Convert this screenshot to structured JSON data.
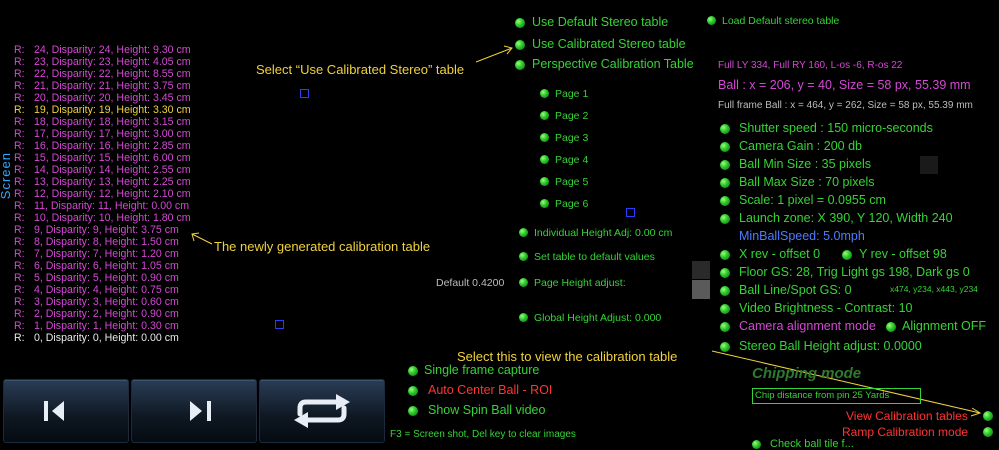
{
  "vertical_label": "Screen",
  "calibration_table": {
    "rows": [
      {
        "r": "R:",
        "text": "24, Disparity: 24, Height: 9.30 cm",
        "style": "pink"
      },
      {
        "r": "R:",
        "text": "23, Disparity: 23, Height: 4.05 cm",
        "style": "pink"
      },
      {
        "r": "R:",
        "text": "22, Disparity: 22, Height: 8.55 cm",
        "style": "pink"
      },
      {
        "r": "R:",
        "text": "21, Disparity: 21, Height: 3.75 cm",
        "style": "pink"
      },
      {
        "r": "R:",
        "text": "20, Disparity: 20, Height: 3.45 cm",
        "style": "pink"
      },
      {
        "r": "R:",
        "text": "19, Disparity: 19, Height: 3.30 cm",
        "style": "yellow"
      },
      {
        "r": "R:",
        "text": "18, Disparity: 18, Height: 3.15 cm",
        "style": "pink"
      },
      {
        "r": "R:",
        "text": "17, Disparity: 17, Height: 3.00 cm",
        "style": "pink"
      },
      {
        "r": "R:",
        "text": "16, Disparity: 16, Height: 2.85 cm",
        "style": "pink"
      },
      {
        "r": "R:",
        "text": "15, Disparity: 15, Height: 6.00 cm",
        "style": "pink"
      },
      {
        "r": "R:",
        "text": "14, Disparity: 14, Height: 2.55 cm",
        "style": "pink"
      },
      {
        "r": "R:",
        "text": "13, Disparity: 13, Height: 2.25 cm",
        "style": "pink"
      },
      {
        "r": "R:",
        "text": "12, Disparity: 12, Height: 2.10 cm",
        "style": "pink"
      },
      {
        "r": "R:",
        "text": "11, Disparity: 11, Height: 0.00 cm",
        "style": "pink"
      },
      {
        "r": "R:",
        "text": "10, Disparity: 10, Height: 1.80 cm",
        "style": "pink"
      },
      {
        "r": "R:",
        "text": "9, Disparity: 9, Height: 3.75 cm",
        "style": "pink"
      },
      {
        "r": "R:",
        "text": "8, Disparity: 8, Height: 1.50 cm",
        "style": "pink"
      },
      {
        "r": "R:",
        "text": "7, Disparity: 7, Height: 1.20 cm",
        "style": "pink"
      },
      {
        "r": "R:",
        "text": "6, Disparity: 6, Height: 1.05 cm",
        "style": "pink"
      },
      {
        "r": "R:",
        "text": "5, Disparity: 5, Height: 0.90 cm",
        "style": "pink"
      },
      {
        "r": "R:",
        "text": "4, Disparity: 4, Height: 0.75 cm",
        "style": "pink"
      },
      {
        "r": "R:",
        "text": "3, Disparity: 3, Height: 0.60 cm",
        "style": "pink"
      },
      {
        "r": "R:",
        "text": "2, Disparity: 2, Height: 0.90 cm",
        "style": "pink"
      },
      {
        "r": "R:",
        "text": "1, Disparity: 1, Height: 0.30 cm",
        "style": "pink"
      },
      {
        "r": "R:",
        "text": "0, Disparity: 0, Height: 0.00 cm",
        "style": "white"
      }
    ]
  },
  "annotations": {
    "select_calibrated": "Select “Use Calibrated Stereo” table",
    "new_table": "The newly generated calibration table",
    "view_table": "Select this to view the calibration table"
  },
  "stereo_options": {
    "default": "Use Default Stereo table",
    "calibrated": "Use Calibrated Stereo table",
    "perspective": "Perspective Calibration Table",
    "load_default": "Load Default stereo table"
  },
  "pages": [
    "Page 1",
    "Page 2",
    "Page 3",
    "Page 4",
    "Page 5",
    "Page 6"
  ],
  "height_controls": {
    "individual": "Individual Height Adj: 0.00 cm",
    "set_default": "Set table to default values",
    "default_value": "Default 0.4200",
    "page_height": "Page Height adjust:",
    "global": "Global Height Adjust: 0.000"
  },
  "info": {
    "full_line": "Full LY 334, Full RY 160, L-os -6, R-os 22",
    "ball": "Ball : x = 206, y = 40, Size = 58 px, 55.39 mm",
    "full_frame": "Full frame Ball : x = 464, y = 262, Size = 58 px, 55.39 mm"
  },
  "settings": {
    "shutter": "Shutter speed : 150 micro-seconds",
    "gain": "Camera Gain : 200 db",
    "min_size": "Ball Min Size : 35 pixels",
    "max_size": "Ball Max Size : 70 pixels",
    "scale": "Scale: 1 pixel = 0.0955 cm",
    "launch": "Launch zone: X 390, Y 120, Width 240",
    "min_speed": "MinBallSpeed: 5.0mph",
    "x_rev": "X rev - offset 0",
    "y_rev": "Y rev - offset 98",
    "floor": "Floor GS: 28, Trig Light gs 198, Dark gs 0",
    "ball_line": "Ball Line/Spot GS: 0",
    "coords": "x474, y234, x443, y234",
    "video": "Video Brightness - Contrast: 10",
    "cam_align": "Camera alignment mode",
    "align_off": "Alignment OFF",
    "stereo_height": "Stereo Ball Height adjust: 0.0000"
  },
  "capture": {
    "single": "Single frame capture",
    "auto_center": "Auto Center Ball - ROI",
    "spin": "Show Spin Ball video",
    "hint": "F3 = Screen shot, Del key to clear images"
  },
  "chipping": {
    "title": "Chipping mode",
    "distance": "Chip distance from pin 25 Yards"
  },
  "bottom_right": {
    "view_tables": "View Calibration tables",
    "ramp": "Ramp Calibration mode",
    "cut": "Check ball tile f..."
  }
}
